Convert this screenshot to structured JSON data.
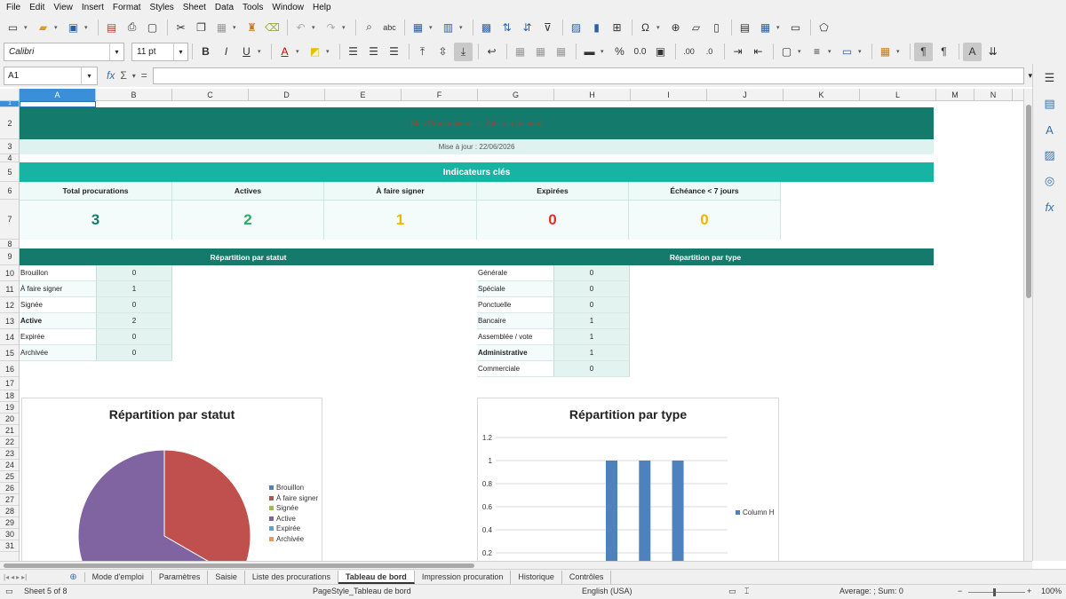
{
  "menu": [
    "File",
    "Edit",
    "View",
    "Insert",
    "Format",
    "Styles",
    "Sheet",
    "Data",
    "Tools",
    "Window",
    "Help"
  ],
  "toolbar": {
    "font_name": "Calibri",
    "font_size": "11 pt"
  },
  "formula": {
    "cell_ref": "A1",
    "fx": "fx",
    "sigma": "Σ",
    "equals": "="
  },
  "columns": [
    "A",
    "B",
    "C",
    "D",
    "E",
    "F",
    "G",
    "H",
    "I",
    "J",
    "K",
    "L",
    "M",
    "N"
  ],
  "rows": [
    "1",
    "2",
    "3",
    "4",
    "5",
    "6",
    "7",
    "8",
    "9",
    "10",
    "11",
    "12",
    "13",
    "14",
    "15",
    "16",
    "17",
    "18",
    "19",
    "20",
    "21",
    "22",
    "23",
    "24",
    "25",
    "26",
    "27",
    "28",
    "29",
    "30",
    "31"
  ],
  "dashboard": {
    "title": "Mes Procurations — Tableau de bord",
    "updated": "Mise à jour : 22/06/2026",
    "kpi_header": "Indicateurs clés",
    "kpis": [
      {
        "label": "Total procurations",
        "value": "3",
        "color": "#137a6c"
      },
      {
        "label": "Actives",
        "value": "2",
        "color": "#27ae60"
      },
      {
        "label": "À faire signer",
        "value": "1",
        "color": "#e6b800"
      },
      {
        "label": "Expirées",
        "value": "0",
        "color": "#e0302a"
      },
      {
        "label": "Échéance < 7 jours",
        "value": "0",
        "color": "#f0b400"
      }
    ],
    "status_section": "Répartition par statut",
    "type_section": "Répartition par type",
    "status_rows": [
      {
        "label": "Brouillon",
        "value": "0"
      },
      {
        "label": "À faire signer",
        "value": "1"
      },
      {
        "label": "Signée",
        "value": "0"
      },
      {
        "label": "Active",
        "value": "2"
      },
      {
        "label": "Expirée",
        "value": "0"
      },
      {
        "label": "Archivée",
        "value": "0"
      }
    ],
    "type_rows": [
      {
        "label": "Générale",
        "value": "0"
      },
      {
        "label": "Spéciale",
        "value": "0"
      },
      {
        "label": "Ponctuelle",
        "value": "0"
      },
      {
        "label": "Bancaire",
        "value": "1"
      },
      {
        "label": "Assemblée / vote",
        "value": "1"
      },
      {
        "label": "Administrative",
        "value": "1"
      },
      {
        "label": "Commerciale",
        "value": "0"
      }
    ]
  },
  "chart_data": [
    {
      "type": "pie",
      "title": "Répartition par statut",
      "categories": [
        "Brouillon",
        "À faire signer",
        "Signée",
        "Active",
        "Expirée",
        "Archivée"
      ],
      "values": [
        0,
        1,
        0,
        2,
        0,
        0
      ],
      "colors": [
        "#4f81bd",
        "#c0504d",
        "#9bbb59",
        "#8064a2",
        "#4bacc6",
        "#f79646"
      ],
      "legend": "right"
    },
    {
      "type": "bar",
      "title": "Répartition par type",
      "categories": [
        "Générale",
        "Spéciale",
        "Ponctuelle",
        "Bancaire",
        "Assemblée / vote",
        "Administrative",
        "Commerciale"
      ],
      "series": [
        {
          "name": "Column H",
          "values": [
            0,
            0,
            0,
            1,
            1,
            1,
            0
          ]
        }
      ],
      "ylim": [
        0,
        1.2
      ],
      "yticks": [
        "1.2",
        "1",
        "0.8",
        "0.6",
        "0.4",
        "0.2"
      ],
      "color": "#4f81bd",
      "grid": true,
      "legend": "right"
    }
  ],
  "tabs": [
    "Mode d'emploi",
    "Paramètres",
    "Saisie",
    "Liste des procurations",
    "Tableau de bord",
    "Impression procuration",
    "Historique",
    "Contrôles"
  ],
  "active_tab": "Tableau de bord",
  "status": {
    "sheet": "Sheet 5 of 8",
    "pagestyle": "PageStyle_Tableau de bord",
    "language": "English (USA)",
    "summary": "Average: ; Sum: 0",
    "zoom": "100%"
  }
}
